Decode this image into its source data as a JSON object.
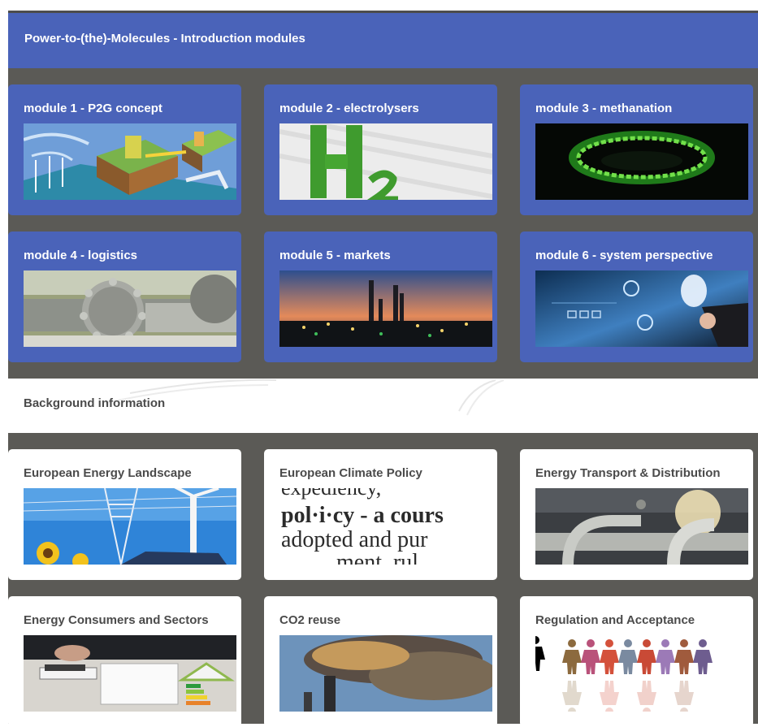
{
  "header": {
    "title": "Power-to-(the)-Molecules - Introduction modules"
  },
  "modules": [
    {
      "title": "module 1 - P2G concept"
    },
    {
      "title": "module 2 - electrolysers"
    },
    {
      "title": "module 3 - methanation"
    },
    {
      "title": "module 4 - logistics"
    },
    {
      "title": "module 5 - markets"
    },
    {
      "title": "module 6 - system perspective"
    }
  ],
  "background": {
    "title": "Background information",
    "items": [
      {
        "title": "European Energy Landscape"
      },
      {
        "title": "European Climate Policy"
      },
      {
        "title": "Energy Transport & Distribution"
      },
      {
        "title": "Energy Consumers and Sectors"
      },
      {
        "title": "CO2 reuse"
      },
      {
        "title": "Regulation and Acceptance"
      }
    ]
  },
  "policy_image_text": {
    "line1": "expediency,",
    "line2": "pol·i·cy - a cours",
    "line3": "adopted and pur",
    "line4": "ment, rul"
  },
  "colors": {
    "module_blue": "#4a63b9",
    "dark_gap": "#5b5a56",
    "white": "#ffffff",
    "card_title_dark": "#4b4b4b"
  }
}
